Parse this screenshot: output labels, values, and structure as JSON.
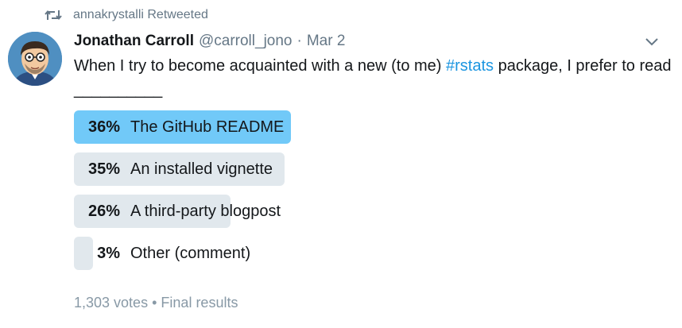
{
  "retweet": {
    "text": "annakrystalli Retweeted"
  },
  "tweet": {
    "author_name": "Jonathan Carroll",
    "author_handle": "@carroll_jono",
    "separator": "·",
    "date": "Mar 2",
    "text_before": "When I try to become acquainted with a new (to me) ",
    "hashtag": "#rstats",
    "text_after": " package, I prefer to read __________"
  },
  "poll": {
    "options": [
      {
        "percent_label": "36%",
        "label": "The GitHub README",
        "percent": 36,
        "leading": true
      },
      {
        "percent_label": "35%",
        "label": "An installed vignette",
        "percent": 35,
        "leading": false
      },
      {
        "percent_label": "26%",
        "label": "A third-party blogpost",
        "percent": 26,
        "leading": false
      },
      {
        "percent_label": "3%",
        "label": "Other (comment)",
        "percent": 3,
        "leading": false
      }
    ],
    "votes": "1,303 votes",
    "footer_separator": "•",
    "status": "Final results"
  },
  "colors": {
    "leading_bar": "#71c9f8",
    "other_bar": "#e1e8ed",
    "hashtag": "#1b95e0",
    "muted": "#657786"
  },
  "icons": {
    "retweet": "retweet-icon",
    "menu": "chevron-down-icon",
    "avatar": "avatar"
  }
}
